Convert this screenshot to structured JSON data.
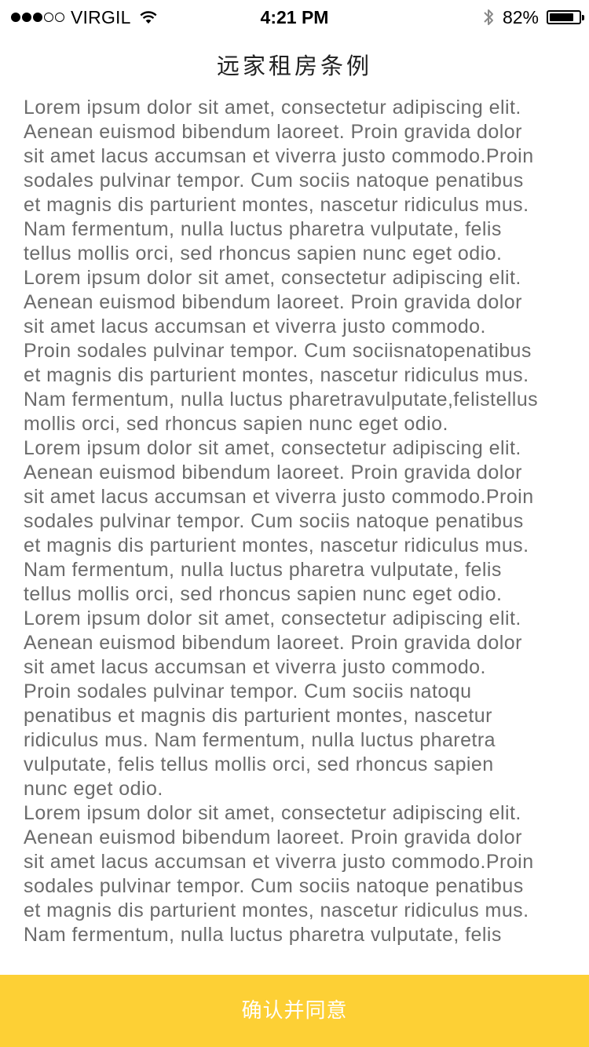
{
  "status_bar": {
    "carrier": "VIRGIL",
    "time": "4:21 PM",
    "battery_percent_label": "82%",
    "battery_level": 0.82,
    "signal_bars_filled": 3,
    "signal_bars_total": 5,
    "icons": [
      "signal-dots-icon",
      "wifi-icon",
      "bluetooth-icon",
      "battery-icon"
    ]
  },
  "page": {
    "title": "远家租房条例",
    "paragraphs": [
      "Lorem ipsum dolor sit amet, consectetur adipiscing elit.\nAenean euismod bibendum laoreet. Proin gravida dolor\nsit amet lacus accumsan et viverra justo commodo.Proin\nsodales pulvinar tempor. Cum sociis natoque penatibus\net magnis dis parturient montes, nascetur ridiculus mus.\nNam fermentum, nulla luctus pharetra vulputate, felis\ntellus mollis orci, sed rhoncus sapien nunc eget odio.",
      "Lorem ipsum dolor sit amet, consectetur adipiscing elit.\nAenean euismod bibendum laoreet. Proin gravida dolor\nsit amet lacus accumsan et viverra justo commodo.\nProin sodales pulvinar tempor. Cum sociisnatopenatibus\net magnis dis parturient montes, nascetur ridiculus mus.\nNam fermentum, nulla luctus pharetravulputate,felistellus\nmollis orci, sed rhoncus sapien nunc eget odio.",
      "Lorem ipsum dolor sit amet, consectetur adipiscing elit.\nAenean euismod bibendum laoreet. Proin gravida dolor\nsit amet lacus accumsan et viverra justo commodo.Proin\nsodales pulvinar tempor. Cum sociis natoque penatibus\net magnis dis parturient montes, nascetur ridiculus mus.\nNam fermentum, nulla luctus pharetra vulputate, felis\ntellus mollis orci, sed rhoncus sapien nunc eget odio.",
      "Lorem ipsum dolor sit amet, consectetur adipiscing elit.\nAenean euismod bibendum laoreet. Proin gravida dolor\nsit amet lacus accumsan et viverra justo commodo.\nProin sodales pulvinar tempor. Cum sociis natoqu\npenatibus et magnis dis parturient montes, nascetur\nridiculus mus. Nam fermentum, nulla luctus pharetra\nvulputate, felis tellus mollis orci, sed rhoncus sapien\nnunc eget odio.",
      "Lorem ipsum dolor sit amet, consectetur adipiscing elit.\nAenean euismod bibendum laoreet. Proin gravida dolor\nsit amet lacus accumsan et viverra justo commodo.Proin\nsodales pulvinar tempor. Cum sociis natoque penatibus\net magnis dis parturient montes, nascetur ridiculus mus.\nNam fermentum, nulla luctus pharetra vulputate, felis"
    ]
  },
  "footer": {
    "confirm_label": "确认并同意"
  },
  "colors": {
    "accent": "#fdd035",
    "body_text": "#6b6b6b",
    "title_text": "#222222",
    "button_text": "#ffffff"
  }
}
